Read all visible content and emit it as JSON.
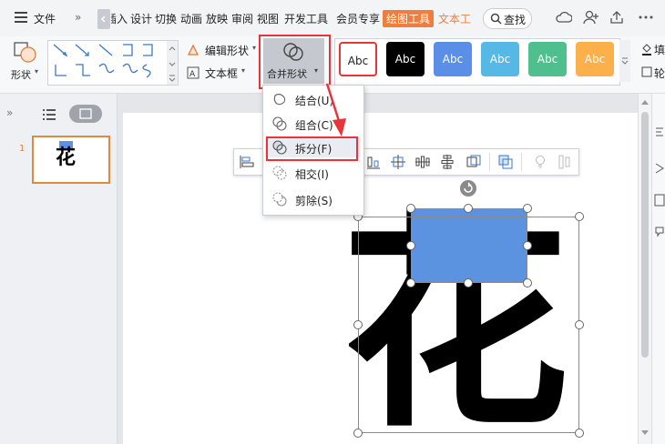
{
  "menubar": {
    "file": "文件",
    "more": "»",
    "tabs": [
      "插入",
      "设计",
      "切换",
      "动画",
      "放映",
      "审阅",
      "视图",
      "开发工具",
      "会员专享",
      "绘图工具",
      "文本工"
    ],
    "insert_partial": "插入",
    "active_tab": "绘图工具",
    "search": "查找"
  },
  "ribbon": {
    "shape_label": "形状",
    "edit_shape": "编辑形状",
    "text_box": "文本框",
    "merge_shapes": "合并形状",
    "style_label": "Abc",
    "fill_partial": "填",
    "outline_partial": "轮"
  },
  "colors": {
    "accent_orange": "#f07d3c",
    "highlight_red": "#e8353a",
    "shape_blue": "#5b93e0",
    "swatch_black": "#000000",
    "swatch_blue": "#5b8ee6",
    "swatch_cyan": "#56b8e4",
    "swatch_green": "#4fc08d",
    "swatch_orange": "#fbb04a"
  },
  "dropdown": {
    "items": [
      {
        "label": "结合(U)",
        "icon": "union-icon"
      },
      {
        "label": "组合(C)",
        "icon": "combine-icon"
      },
      {
        "label": "拆分(F)",
        "icon": "fragment-icon"
      },
      {
        "label": "相交(I)",
        "icon": "intersect-icon"
      },
      {
        "label": "剪除(S)",
        "icon": "subtract-icon"
      }
    ],
    "highlighted": "拆分(F)"
  },
  "slides": {
    "number": "1",
    "thumb_char": "花"
  },
  "canvas": {
    "big_char": "花"
  }
}
